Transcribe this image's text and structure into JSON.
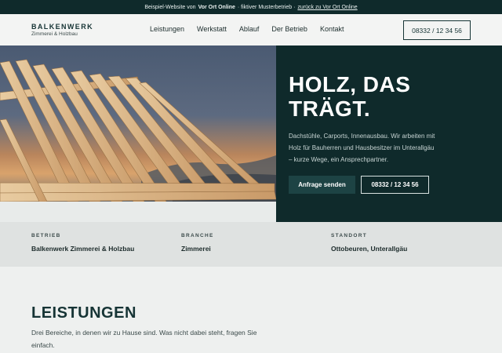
{
  "topbar": {
    "prefix": "Beispiel-Website von",
    "brand": "Vor Ort Online",
    "middle": "· fiktiver Musterbetrieb ·",
    "link": "zurück zu Vor Ort Online"
  },
  "header": {
    "logo_name": "BALKENWERK",
    "logo_sub": "Zimmerei & Holzbau",
    "nav": [
      "Leistungen",
      "Werkstatt",
      "Ablauf",
      "Der Betrieb",
      "Kontakt"
    ],
    "phone": "08332 / 12 34 56"
  },
  "hero": {
    "title_line1": "HOLZ, DAS",
    "title_line2": "TRÄGT.",
    "text": "Dachstühle, Carports, Innenausbau. Wir arbeiten mit Holz für Bauherren und Hausbesitzer im Unterallgäu – kurze Wege, ein Ansprechpartner.",
    "primary_button": "Anfrage senden",
    "secondary_button": "08332 / 12 34 56"
  },
  "facts": [
    {
      "label": "BETRIEB",
      "value": "Balkenwerk Zimmerei & Holzbau"
    },
    {
      "label": "BRANCHE",
      "value": "Zimmerei"
    },
    {
      "label": "STANDORT",
      "value": "Ottobeuren, Unterallgäu"
    }
  ],
  "services": {
    "heading": "LEISTUNGEN",
    "intro": "Drei Bereiche, in denen wir zu Hause sind. Was nicht dabei steht, fragen Sie einfach."
  },
  "colors": {
    "dark_teal": "#0f2a2b",
    "button_teal": "#1d4344",
    "page_bg": "#eef0ef"
  }
}
